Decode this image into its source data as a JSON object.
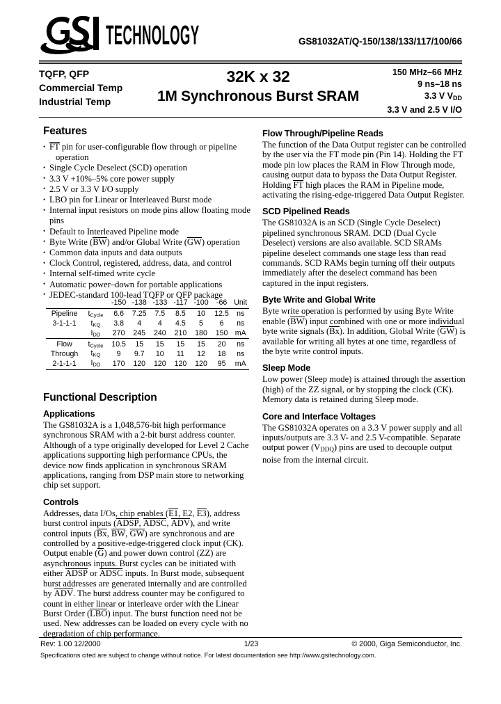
{
  "header": {
    "logo_text": "TECHNOLOGY",
    "logo_mark": "GSI",
    "part_number": "GS81032AT/Q-150/138/133/117/100/66"
  },
  "title_band": {
    "left_lines": [
      "TQFP,  QFP",
      "Commercial Temp",
      "Industrial Temp"
    ],
    "center_line1": "32K x 32",
    "center_line2": "1M Synchronous Burst SRAM",
    "right_lines": [
      "150 MHz–66 MHz",
      "9 ns–18 ns",
      "3.3 V V",
      "3.3 V and 2.5 V I/O"
    ],
    "right_vdd_sub": "DD"
  },
  "features": {
    "heading": "Features",
    "items": [
      {
        "pre": "",
        "ovl": "FT",
        "post": " pin for user-configurable flow through or pipeline",
        "cont": "operation"
      },
      {
        "pre": "Single Cycle Deselect (SCD) operation",
        "ovl": "",
        "post": "",
        "cont": ""
      },
      {
        "pre": "3.3 V +10%–5% core power supply",
        "ovl": "",
        "post": "",
        "cont": ""
      },
      {
        "pre": "2.5 V or 3.3 V I/O supply",
        "ovl": "",
        "post": "",
        "cont": ""
      },
      {
        "pre": "LBO pin for Linear or Interleaved Burst mode",
        "ovl": "",
        "post": "",
        "cont": ""
      },
      {
        "pre": "Internal input resistors on mode pins allow floating mode pins",
        "ovl": "",
        "post": "",
        "cont": ""
      },
      {
        "pre": "Default to Interleaved Pipeline mode",
        "ovl": "",
        "post": "",
        "cont": ""
      },
      {
        "pre": "Byte Write (",
        "ovl": "BW",
        "post": ") and/or Global Write (GW) operation",
        "cont": ""
      },
      {
        "pre": "Common data inputs and data outputs",
        "ovl": "",
        "post": "",
        "cont": ""
      },
      {
        "pre": "Clock Control, registered, address, data, and control",
        "ovl": "",
        "post": "",
        "cont": ""
      },
      {
        "pre": "Internal self-timed write cycle",
        "ovl": "",
        "post": "",
        "cont": ""
      },
      {
        "pre": "Automatic power–down for portable applications",
        "ovl": "",
        "post": "",
        "cont": ""
      },
      {
        "pre": "JEDEC-standard 100-lead TQFP or QFP  package",
        "ovl": "",
        "post": "",
        "cont": ""
      }
    ]
  },
  "timing_table": {
    "speed_grades": [
      "-150",
      "-138",
      "-133",
      "-117",
      "-100",
      "-66"
    ],
    "unit_header": "Unit",
    "groups": [
      {
        "name_lines": [
          "Pipeline",
          "3-1-1-1",
          ""
        ],
        "rows": [
          {
            "param": "tCycle",
            "param_base": "t",
            "param_sub": "Cycle",
            "values": [
              "6.6",
              "7.25",
              "7.5",
              "8.5",
              "10",
              "12.5"
            ],
            "unit": "ns"
          },
          {
            "param": "tKQ",
            "param_base": "t",
            "param_sub": "KQ",
            "values": [
              "3.8",
              "4",
              "4",
              "4.5",
              "5",
              "6"
            ],
            "unit": "ns"
          },
          {
            "param": "IDD",
            "param_base": "I",
            "param_sub": "DD",
            "values": [
              "270",
              "245",
              "240",
              "210",
              "180",
              "150"
            ],
            "unit": "mA"
          }
        ]
      },
      {
        "name_lines": [
          "Flow",
          "Through",
          "2-1-1-1"
        ],
        "rows": [
          {
            "param": "tCycle",
            "param_base": "t",
            "param_sub": "Cycle",
            "values": [
              "10.5",
              "15",
              "15",
              "15",
              "15",
              "20"
            ],
            "unit": "ns"
          },
          {
            "param": "tKQ",
            "param_base": "t",
            "param_sub": "KQ",
            "values": [
              "9",
              "9.7",
              "10",
              "11",
              "12",
              "18"
            ],
            "unit": "ns"
          },
          {
            "param": "IDD",
            "param_base": "I",
            "param_sub": "DD",
            "values": [
              "170",
              "120",
              "120",
              "120",
              "120",
              "95"
            ],
            "unit": "mA"
          }
        ]
      }
    ]
  },
  "functional_description": {
    "heading": "Functional Description",
    "applications": {
      "heading": "Applications",
      "text": "The GS81032A is a 1,048,576-bit high performance synchronous SRAM with a 2-bit burst address counter. Although of a type originally developed for Level 2 Cache applications supporting high performance CPUs, the device now finds application in synchronous SRAM applications, ranging from DSP main store to networking chip set support."
    },
    "controls": {
      "heading": "Controls",
      "p1_a": "Addresses, data I/Os, chip enables (",
      "p1_e1": "E1",
      "p1_b": ", E2, ",
      "p1_e3": "E3",
      "p1_c": "), address burst control inputs (",
      "p1_adsp": "ADSP",
      "p1_d": ", ",
      "p1_adsc": "ADSC",
      "p1_e": ", ",
      "p1_adv": "ADV",
      "p1_f": "), and write control inputs (",
      "p1_bx": "Bx",
      "p1_g": ", ",
      "p1_bw": "BW",
      "p1_h": ", ",
      "p1_gw": "GW",
      "p1_i": ") are synchronous and are controlled by a positive-edge-triggered clock input (CK). Output enable (",
      "p1_gbar": "G",
      "p1_j": ") and power down control (ZZ) are asynchronous inputs. Burst cycles can be initiated with either ",
      "p1_adsp2": "ADSP",
      "p1_k": " or ",
      "p1_adsc2": "ADSC",
      "p1_l": " inputs. In Burst mode, subsequent burst addresses are generated internally and are controlled by ",
      "p1_adv2": "ADV",
      "p1_m": ". The burst address counter may be configured to count in either linear or interleave order with the Linear Burst Order (",
      "p1_lbo": "LBO",
      "p1_n": ") input. The burst function need not be used. New addresses can be loaded on every cycle with no degradation of chip performance."
    }
  },
  "right_column": {
    "flow_through": {
      "heading": "Flow Through/Pipeline Reads",
      "a": "The function of the Data Output register can be controlled by the user via the FT mode pin (Pin 14).  Holding the FT mode pin low places the RAM in Flow Through mode, causing output data to bypass the Data Output Register. Holding ",
      "ft_ovl": "FT",
      "b": " high places the RAM in Pipeline mode, activating the rising-edge-triggered Data Output Register."
    },
    "scd": {
      "heading": "SCD Pipelined Reads",
      "text": "The GS81032A is an SCD (Single Cycle Deselect) pipelined synchronous SRAM. DCD (Dual Cycle Deselect) versions are also available. SCD SRAMs pipeline deselect commands one stage less than read commands. SCD RAMs begin turning off their outputs immediately after the deselect command has been captured in the input registers."
    },
    "byte_write": {
      "heading": "Byte Write and Global Write",
      "a": "Byte write operation is performed by using Byte Write enable (",
      "bw_ovl": "BW",
      "b": ") input combined with one or more individual byte write signals (",
      "bx_ovl": "Bx",
      "c": "). In addition, Global Write (",
      "gw_ovl": "GW",
      "d": ") is available for writing all bytes at one time, regardless of the byte write control inputs."
    },
    "sleep_mode": {
      "heading": "Sleep Mode",
      "text": "Low power (Sleep mode) is attained through the assertion (high) of the ZZ signal, or by stopping the clock (CK). Memory data is retained during Sleep mode."
    },
    "core_voltages": {
      "heading": "Core and Interface Voltages",
      "a": "The GS81032A operates on a 3.3 V power supply and all inputs/outputs are 3.3 V- and 2.5 V-compatible. Separate output power (V",
      "vddq_sub": "DDQ",
      "b": ") pins are used to decouple output noise from the internal circuit."
    }
  },
  "footer": {
    "rev": "Rev: 1.00  12/2000",
    "page": "1/23",
    "copyright": "© 2000, Giga Semiconductor, Inc.",
    "disclaimer": "Specifications cited are subject to change without notice. For latest documentation see http://www.gsitechnology.com."
  }
}
